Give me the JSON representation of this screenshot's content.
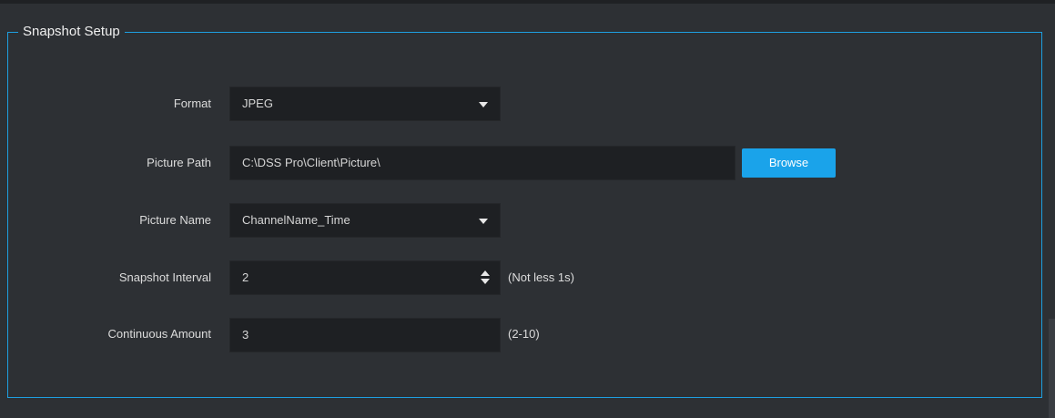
{
  "section": {
    "title": "Snapshot Setup"
  },
  "colors": {
    "accent": "#1aa3ea",
    "border": "#1e9fe0",
    "background": "#2d3034",
    "field": "#1e2023"
  },
  "form": {
    "format": {
      "label": "Format",
      "value": "JPEG",
      "icon": "chevron-down-icon"
    },
    "picture_path": {
      "label": "Picture Path",
      "value": "C:\\DSS Pro\\Client\\Picture\\",
      "browse_label": "Browse"
    },
    "picture_name": {
      "label": "Picture Name",
      "value": "ChannelName_Time",
      "icon": "chevron-down-icon"
    },
    "snapshot_interval": {
      "label": "Snapshot Interval",
      "value": "2",
      "hint": "(Not less 1s)",
      "icon": "spinner-icon"
    },
    "continuous_amount": {
      "label": "Continuous Amount",
      "value": "3",
      "hint": "(2-10)"
    }
  }
}
